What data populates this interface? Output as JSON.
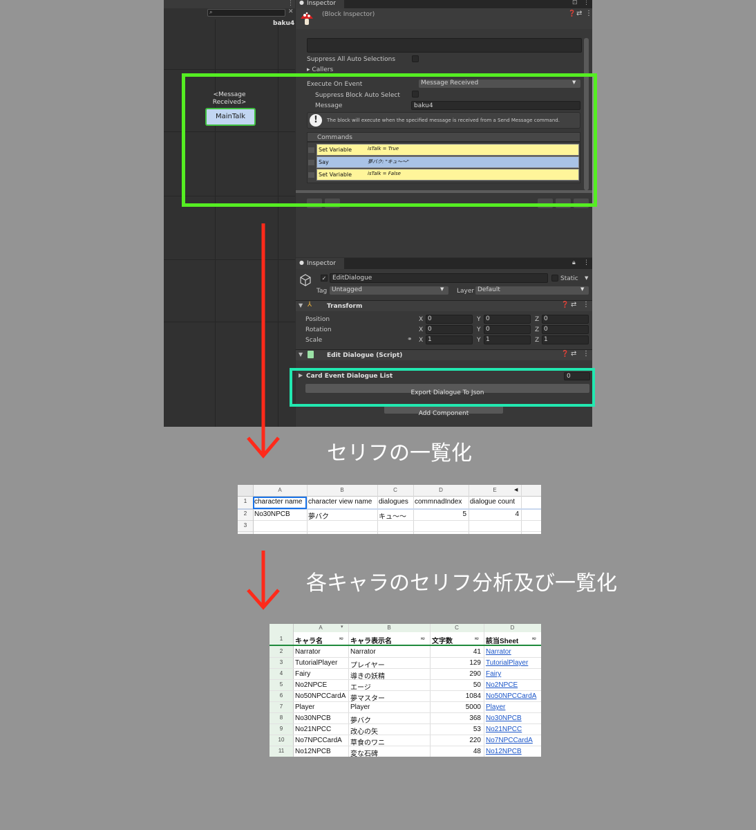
{
  "flowchart": {
    "block_label": "baku4",
    "event_label_line1": "<Message",
    "event_label_line2": "Received>",
    "block_button": "MainTalk"
  },
  "block_inspector": {
    "tab_title": "Inspector",
    "subtitle": "(Block Inspector)",
    "suppress_all_auto": "Suppress All Auto Selections",
    "callers": "Callers",
    "execute_on_event_label": "Execute On Event",
    "execute_on_event_value": "Message Received",
    "suppress_block_auto": "Suppress Block Auto Select",
    "message_label": "Message",
    "message_value": "baku4",
    "info_text": "The block will execute when the specified message is received from a Send Message command.",
    "commands_title": "Commands",
    "commands": [
      {
        "name": "Set Variable",
        "summary": "isTalk = True",
        "color": "#fff59a"
      },
      {
        "name": "Say",
        "summary": "夢バク: \"キュ〜〜\"",
        "color": "#a9c3e6"
      },
      {
        "name": "Set Variable",
        "summary": "isTalk = False",
        "color": "#fff59a"
      }
    ]
  },
  "object_inspector": {
    "tab_title": "Inspector",
    "object_name": "EditDialogue",
    "static_label": "Static",
    "tag_label": "Tag",
    "tag_value": "Untagged",
    "layer_label": "Layer",
    "layer_value": "Default",
    "transform_title": "Transform",
    "transform_rows": [
      {
        "label": "Position",
        "x": "0",
        "y": "0",
        "z": "0"
      },
      {
        "label": "Rotation",
        "x": "0",
        "y": "0",
        "z": "0"
      },
      {
        "label": "Scale",
        "x": "1",
        "y": "1",
        "z": "1"
      }
    ],
    "axis_x": "X",
    "axis_y": "Y",
    "axis_z": "Z",
    "script_title": "Edit Dialogue (Script)",
    "list_label": "Card Event Dialogue List",
    "list_count": "0",
    "export_button": "Export Dialogue To Json",
    "add_component": "Add Component"
  },
  "captions": {
    "step1": "セリフの一覧化",
    "step2": "各キャラのセリフ分析及び一覧化"
  },
  "sheet1": {
    "cols": [
      "A",
      "B",
      "C",
      "D",
      "E"
    ],
    "header": [
      "character name",
      "character view name",
      "dialogues",
      "commnadIndex",
      "dialogue count"
    ],
    "rows": [
      [
        "No30NPCB",
        "夢バク",
        "キュ〜〜",
        "5",
        "4"
      ]
    ],
    "row_numbers": [
      "1",
      "2",
      "3"
    ]
  },
  "sheet2": {
    "cols": [
      "A",
      "B",
      "C",
      "D"
    ],
    "header": [
      "キャラ名",
      "キャラ表示名",
      "文字数",
      "該当Sheet"
    ],
    "rows": [
      [
        "Narrator",
        "Narrator",
        "41",
        "Narrator"
      ],
      [
        "TutorialPlayer",
        "プレイヤー",
        "129",
        "TutorialPlayer"
      ],
      [
        "Fairy",
        "導きの妖精",
        "290",
        "Fairy"
      ],
      [
        "No2NPCE",
        "エージ",
        "50",
        "No2NPCE"
      ],
      [
        "No50NPCCardA",
        "夢マスター",
        "1084",
        "No50NPCCardA"
      ],
      [
        "Player",
        "Player",
        "5000",
        "Player"
      ],
      [
        "No30NPCB",
        "夢バク",
        "368",
        "No30NPCB"
      ],
      [
        "No21NPCC",
        "改心の矢",
        "53",
        "No21NPCC"
      ],
      [
        "No7NPCCardA",
        "草食のワニ",
        "220",
        "No7NPCCardA"
      ],
      [
        "No12NPCB",
        "変な石碑",
        "48",
        "No12NPCB"
      ]
    ],
    "row_numbers": [
      "1",
      "2",
      "3",
      "4",
      "5",
      "6",
      "7",
      "8",
      "9",
      "10",
      "11"
    ]
  },
  "colors": {
    "highlight_green": "#55ee22",
    "highlight_teal": "#22e8b0",
    "arrow_red": "#ff2a1a"
  }
}
